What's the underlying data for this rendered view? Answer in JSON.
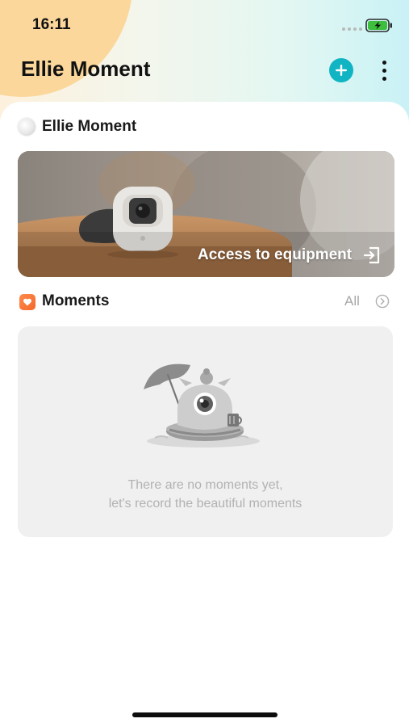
{
  "status_bar": {
    "time": "16:11",
    "battery_state": "charging",
    "battery_color": "#3dbe3d"
  },
  "header": {
    "title": "Ellie Moment",
    "add_icon": "plus-circle-icon",
    "more_icon": "vertical-ellipsis-icon",
    "accent_color": "#10b4c2"
  },
  "device": {
    "name": "Ellie Moment",
    "action_label": "Access to equipment",
    "action_icon": "enter-arrow-icon"
  },
  "moments": {
    "title": "Moments",
    "all_label": "All",
    "empty_line1": "There are no moments yet,",
    "empty_line2": "let's record the beautiful moments",
    "icon_color": "#f36a2a"
  }
}
